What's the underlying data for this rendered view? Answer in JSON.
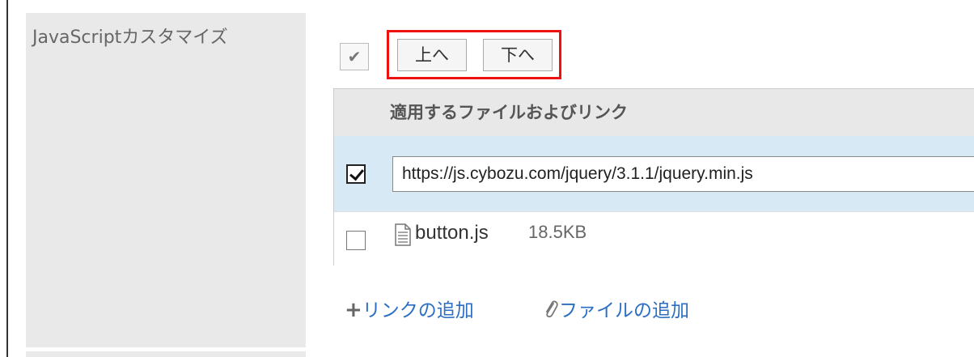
{
  "setting": {
    "label": "JavaScriptカスタマイズ"
  },
  "toolbar": {
    "select_all_icon": "check-icon",
    "up_label": "上へ",
    "down_label": "下へ"
  },
  "table": {
    "header": "適用するファイルおよびリンク",
    "rows": [
      {
        "checked": true,
        "type": "link",
        "value": "https://js.cybozu.com/jquery/3.1.1/jquery.min.js"
      },
      {
        "checked": false,
        "type": "file",
        "name": "button.js",
        "size": "18.5KB"
      }
    ]
  },
  "actions": {
    "add_link": "リンクの追加",
    "add_file": "ファイルの追加"
  },
  "colors": {
    "highlight": "#ee1111",
    "link": "#2b6ec3",
    "selected_row": "#d7e9f5"
  }
}
